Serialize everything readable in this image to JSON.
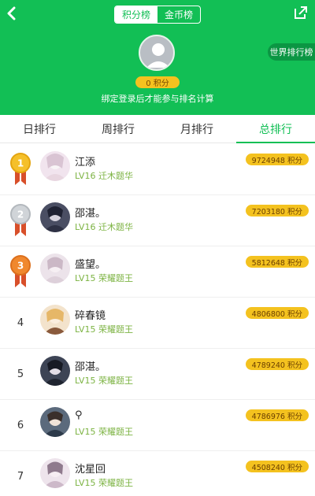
{
  "header": {
    "seg_points": "积分榜",
    "seg_coins": "金币榜",
    "world_rank": "世界排行榜",
    "my_score": "0 积分",
    "bind_tip": "绑定登录后才能参与排名计算"
  },
  "tabs": [
    "日排行",
    "周排行",
    "月排行",
    "总排行"
  ],
  "list": [
    {
      "rank": "1",
      "name": "江添",
      "level": "LV16 迁木题华",
      "score": "9724948 积分"
    },
    {
      "rank": "2",
      "name": "邵湛。",
      "level": "LV16 迁木题华",
      "score": "7203180 积分"
    },
    {
      "rank": "3",
      "name": "盛望。",
      "level": "LV15 荣耀题王",
      "score": "5812648 积分"
    },
    {
      "rank": "4",
      "name": "碎春镜",
      "level": "LV15 荣耀题王",
      "score": "4806800 积分"
    },
    {
      "rank": "5",
      "name": "邵湛。",
      "level": "LV15 荣耀题王",
      "score": "4789240 积分"
    },
    {
      "rank": "6",
      "name": "⚲",
      "level": "LV15 荣耀题王",
      "score": "4786976 积分"
    },
    {
      "rank": "7",
      "name": "沈星回",
      "level": "LV15 荣耀题王",
      "score": "4508240 积分"
    }
  ],
  "colors": {
    "accent": "#12bf55",
    "gold": "#f4c21f",
    "level": "#7cb342"
  }
}
